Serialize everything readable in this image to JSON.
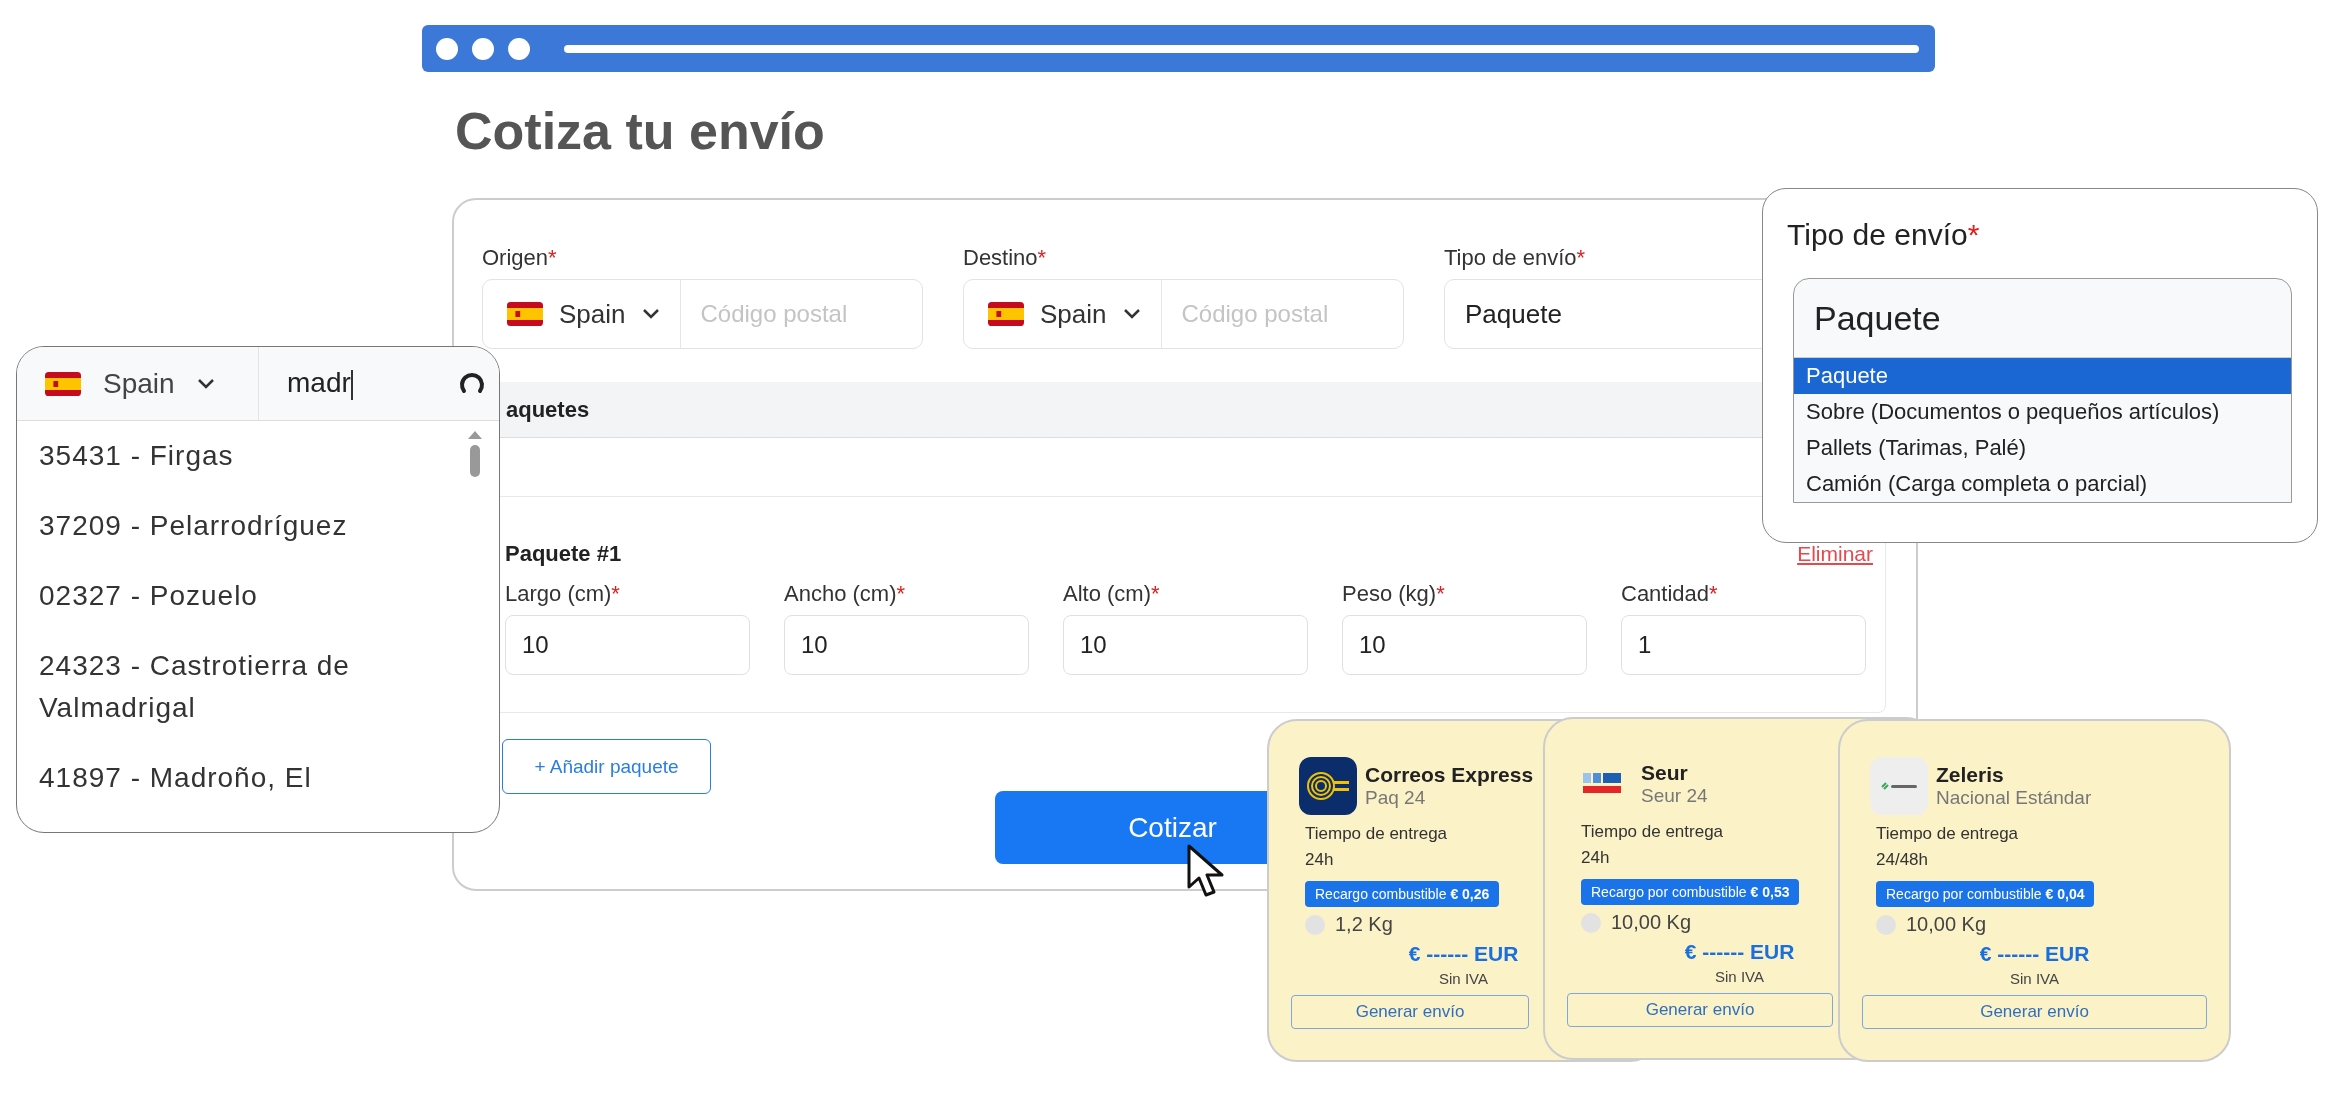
{
  "title": "Cotiza tu envío",
  "form": {
    "origin": {
      "label": "Origen",
      "mark": "*",
      "country": "Spain",
      "placeholder": "Código postal"
    },
    "destination": {
      "label": "Destino",
      "mark": "*",
      "country": "Spain",
      "placeholder": "Código postal"
    },
    "shipment_type": {
      "label": "Tipo de envío",
      "mark": "*",
      "value": "Paquete"
    },
    "packages_header": "aquetes",
    "package": {
      "title": "Paquete #1",
      "remove": "Eliminar",
      "fields": [
        {
          "label": "Largo (cm)",
          "mark": "*",
          "value": "10"
        },
        {
          "label": "Ancho (cm)",
          "mark": "*",
          "value": "10"
        },
        {
          "label": "Alto (cm)",
          "mark": "*",
          "value": "10"
        },
        {
          "label": "Peso (kg)",
          "mark": "*",
          "value": "10"
        },
        {
          "label": "Cantidad",
          "mark": "*",
          "value": "1"
        }
      ]
    },
    "add_button": "+ Añadir paquete",
    "quote_button": "Cotizar"
  },
  "postal_popup": {
    "country": "Spain",
    "query": "madr",
    "results": [
      "35431 - Firgas",
      "37209 - Pelarrodríguez",
      "02327 - Pozuelo",
      "24323 - Castrotierra de Valmadrigal",
      "41897 - Madroño, El"
    ]
  },
  "type_popup": {
    "label": "Tipo de envío",
    "mark": "*",
    "value": "Paquete",
    "options": [
      {
        "label": "Paquete",
        "selected": true
      },
      {
        "label": "Sobre (Documentos o pequeños artículos)",
        "selected": false
      },
      {
        "label": "Pallets (Tarimas, Palé)",
        "selected": false
      },
      {
        "label": "Camión (Carga completa o parcial)",
        "selected": false
      }
    ]
  },
  "carriers": [
    {
      "kind": "correos",
      "name": "Correos Express",
      "service": "Paq 24",
      "delivery_label": "Tiempo de entrega",
      "delivery": "24h",
      "surcharge": "Recargo combustible **€ 0,26**",
      "weight": "1,2 Kg",
      "price": "€ ------ EUR",
      "tax": "Sin IVA",
      "button": "Generar envío"
    },
    {
      "kind": "seur",
      "name": "Seur",
      "service": "Seur 24",
      "delivery_label": "Tiempo de entrega",
      "delivery": "24h",
      "surcharge": "Recargo por combustible **€ 0,53**",
      "weight": "10,00 Kg",
      "price": "€ ------ EUR",
      "tax": "Sin IVA",
      "button": "Generar envío"
    },
    {
      "kind": "zeleris",
      "name": "Zeleris",
      "service": "Nacional Estándar",
      "delivery_label": "Tiempo de entrega",
      "delivery": "24/48h",
      "surcharge": "Recargo por combustible **€ 0,04**",
      "weight": "10,00 Kg",
      "price": "€ ------ EUR",
      "tax": "Sin IVA",
      "button": "Generar envío"
    }
  ]
}
